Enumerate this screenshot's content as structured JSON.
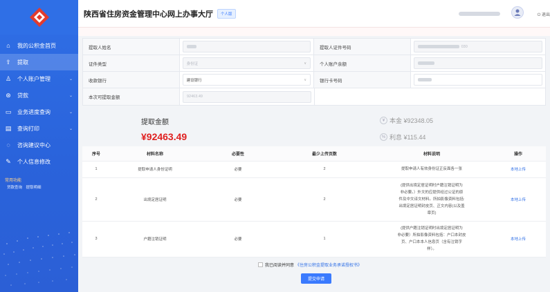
{
  "header": {
    "title": "陕西省住房资金管理中心网上办事大厅",
    "badge": "个人版",
    "logout": "退出"
  },
  "sidebar": {
    "items": [
      {
        "label": "我的公积金首页",
        "icon": "home-icon",
        "arrow": false
      },
      {
        "label": "提取",
        "icon": "upload-icon",
        "arrow": false
      },
      {
        "label": "个人账户管理",
        "icon": "user-icon",
        "arrow": true
      },
      {
        "label": "贷款",
        "icon": "coin-icon",
        "arrow": true
      },
      {
        "label": "业务进度查询",
        "icon": "progress-icon",
        "arrow": true
      },
      {
        "label": "查询打印",
        "icon": "print-icon",
        "arrow": true
      },
      {
        "label": "咨询建议中心",
        "icon": "chat-icon",
        "arrow": false
      },
      {
        "label": "个人信息修改",
        "icon": "edit-icon",
        "arrow": false
      }
    ],
    "common_title": "常用功能",
    "common_links": [
      "贷款查询",
      "提取明细"
    ]
  },
  "form": {
    "name_label": "提取人姓名",
    "id_no_label": "提取人证件号码",
    "id_no_suffix": "030",
    "id_type_label": "证件类型",
    "id_type_value": "身份证",
    "balance_label": "个人账户余额",
    "bank_label": "收款银行",
    "bank_value": "建设银行",
    "card_label": "银行卡号码",
    "available_label": "本次可提取金额",
    "available_value": "92463.49"
  },
  "amount": {
    "title": "提取金额",
    "value": "¥92463.49",
    "principal": "本金 ¥92348.05",
    "interest": "利息 ¥115.44",
    "principal_icon": "yen-icon",
    "interest_icon": "interest-icon"
  },
  "table": {
    "headers": [
      "序号",
      "材料名称",
      "必要性",
      "最少上传页数",
      "材料说明",
      "操作"
    ],
    "rows": [
      {
        "no": "1",
        "name": "提取申请人身份证明",
        "required": "必要",
        "pages": "2",
        "desc": [
          "提取申请人有效身份证正反面各一张"
        ],
        "op": "本地上传"
      },
      {
        "no": "2",
        "name": "出境定居证明",
        "required": "必要",
        "pages": "2",
        "desc": [
          "(提供出境定居证明时户籍注销证明为",
          "非必要。）外文的应提供经过公证的原",
          "件及中文译文材料。所拍影像资料包括:",
          "出境定居证明封皮页、正文内容(以及盖",
          "章页)"
        ],
        "op": "本地上传"
      },
      {
        "no": "3",
        "name": "户籍注销证明",
        "required": "必要",
        "pages": "1",
        "desc": [
          "(提供户籍注销证明时出境定居证明为",
          "非必要）所拍影像资料包括：户口本封皮",
          "页、户口本本人信息页（含有注销字",
          "样）。"
        ],
        "op": "本地上传"
      }
    ]
  },
  "agreement": {
    "prefix": "我已阅读并同意",
    "link": "《住房公积金提取业务承诺授权书》"
  },
  "submit_label": "提交申请",
  "colors": {
    "primary": "#2f6fe6",
    "amount": "#e02020"
  }
}
